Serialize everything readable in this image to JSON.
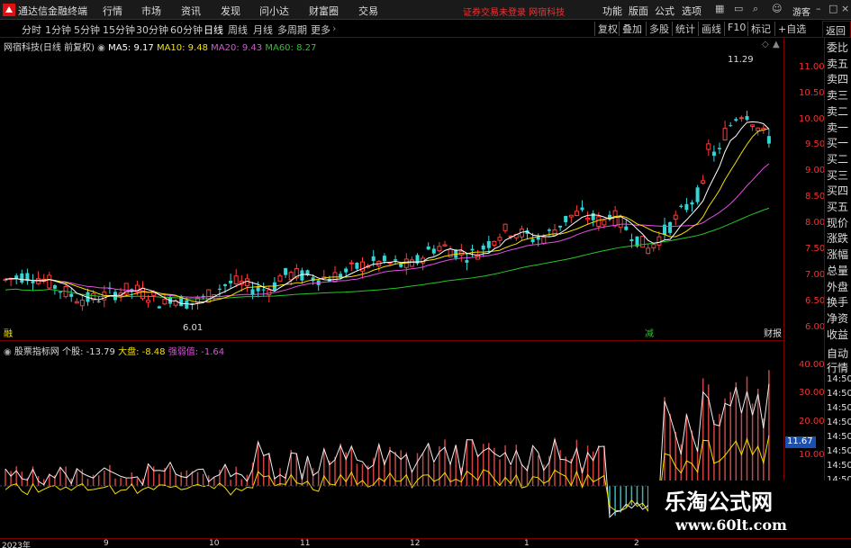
{
  "app": {
    "title": "通达信金融终端",
    "menu": [
      "行情",
      "市场",
      "资讯",
      "发现",
      "问小达",
      "财富圈",
      "交易"
    ],
    "notice": "证券交易未登录  网宿科技",
    "right_menu": [
      "功能",
      "版面",
      "公式",
      "选项"
    ],
    "guest": "游客"
  },
  "periods": [
    "分时",
    "1分钟",
    "5分钟",
    "15分钟",
    "30分钟",
    "60分钟",
    "日线",
    "周线",
    "月线",
    "多周期",
    "更多"
  ],
  "active_period": "日线",
  "tools": [
    "复权",
    "叠加",
    "多股",
    "统计",
    "画线",
    "F10",
    "标记",
    "+自选"
  ],
  "side_tab": "返回",
  "main": {
    "stock_title": "网宿科技(日线 前复权)",
    "ma": [
      {
        "label": "MA5: 9.17",
        "color": "#ffffff"
      },
      {
        "label": "MA10: 9.48",
        "color": "#f5e000"
      },
      {
        "label": "MA20: 9.43",
        "color": "#e050e0"
      },
      {
        "label": "MA60: 8.27",
        "color": "#27c627"
      }
    ],
    "high_label": "11.29",
    "low_label": "6.01",
    "price_ticks": [
      "11.00",
      "10.50",
      "10.00",
      "9.50",
      "9.00",
      "8.50",
      "8.00",
      "7.50",
      "7.00",
      "6.50",
      "6.00"
    ],
    "marker_left": "融",
    "marker_mid": "减",
    "marker_right": "财报"
  },
  "indicator": {
    "name": "股票指标网",
    "stock_label": "个股: -13.79",
    "market_label": "大盘: -8.48",
    "strength_label": "强弱值: -1.64",
    "ticks": [
      "40.00",
      "30.00",
      "20.00",
      "10.00"
    ],
    "current": "11.67"
  },
  "side_labels": [
    "委比",
    "卖五",
    "卖四",
    "卖三",
    "卖二",
    "卖一",
    "买一",
    "买二",
    "买三",
    "买四",
    "买五",
    "现价",
    "涨跌",
    "涨幅",
    "总量",
    "外盘",
    "换手",
    "净资",
    "收益"
  ],
  "side_labels_lower": [
    "自动",
    "行情",
    "14:50",
    "14:50",
    "14:50",
    "14:50",
    "14:50",
    "14:50",
    "14:50",
    "14:50",
    "14:50"
  ],
  "dates": [
    "2023年",
    "9",
    "10",
    "11",
    "12",
    "1",
    "2"
  ],
  "watermark": {
    "title": "乐淘公式网",
    "url": "www.60lt.com"
  },
  "colors": {
    "up": "#ff3b3b",
    "down": "#33d6d6",
    "ma5": "#ffffff",
    "ma10": "#f5e000",
    "ma20": "#e050e0",
    "ma60": "#27c627",
    "axis": "#e33"
  }
}
